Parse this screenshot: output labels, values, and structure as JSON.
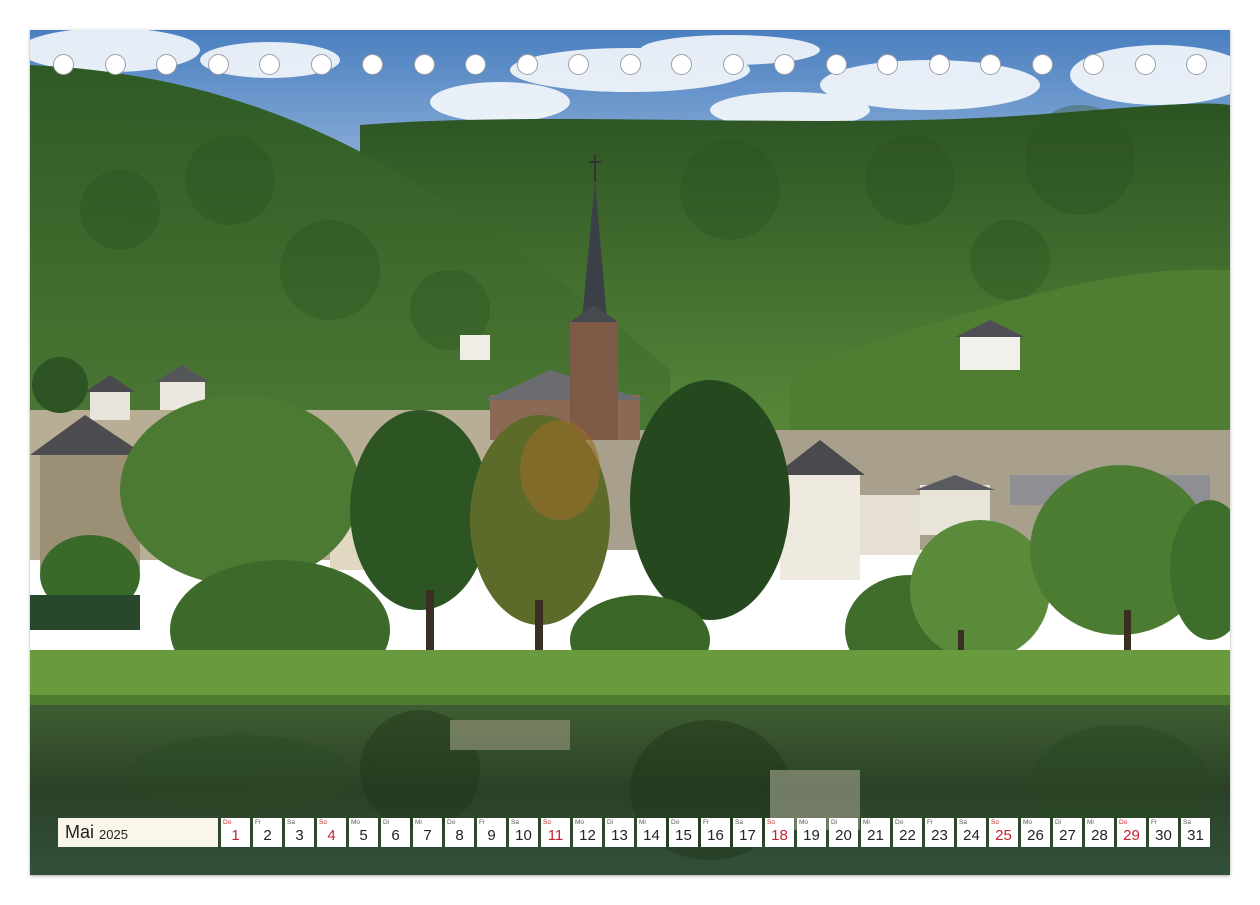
{
  "calendar": {
    "month": "Mai",
    "year": "2025",
    "days": [
      {
        "wd": "Do",
        "n": "1",
        "holiday": true
      },
      {
        "wd": "Fr",
        "n": "2",
        "holiday": false
      },
      {
        "wd": "Sa",
        "n": "3",
        "holiday": false
      },
      {
        "wd": "So",
        "n": "4",
        "holiday": true
      },
      {
        "wd": "Mo",
        "n": "5",
        "holiday": false
      },
      {
        "wd": "Di",
        "n": "6",
        "holiday": false
      },
      {
        "wd": "Mi",
        "n": "7",
        "holiday": false
      },
      {
        "wd": "Do",
        "n": "8",
        "holiday": false
      },
      {
        "wd": "Fr",
        "n": "9",
        "holiday": false
      },
      {
        "wd": "Sa",
        "n": "10",
        "holiday": false
      },
      {
        "wd": "So",
        "n": "11",
        "holiday": true
      },
      {
        "wd": "Mo",
        "n": "12",
        "holiday": false
      },
      {
        "wd": "Di",
        "n": "13",
        "holiday": false
      },
      {
        "wd": "Mi",
        "n": "14",
        "holiday": false
      },
      {
        "wd": "Do",
        "n": "15",
        "holiday": false
      },
      {
        "wd": "Fr",
        "n": "16",
        "holiday": false
      },
      {
        "wd": "Sa",
        "n": "17",
        "holiday": false
      },
      {
        "wd": "So",
        "n": "18",
        "holiday": true
      },
      {
        "wd": "Mo",
        "n": "19",
        "holiday": false
      },
      {
        "wd": "Di",
        "n": "20",
        "holiday": false
      },
      {
        "wd": "Mi",
        "n": "21",
        "holiday": false
      },
      {
        "wd": "Do",
        "n": "22",
        "holiday": false
      },
      {
        "wd": "Fr",
        "n": "23",
        "holiday": false
      },
      {
        "wd": "Sa",
        "n": "24",
        "holiday": false
      },
      {
        "wd": "So",
        "n": "25",
        "holiday": true
      },
      {
        "wd": "Mo",
        "n": "26",
        "holiday": false
      },
      {
        "wd": "Di",
        "n": "27",
        "holiday": false
      },
      {
        "wd": "Mi",
        "n": "28",
        "holiday": false
      },
      {
        "wd": "Do",
        "n": "29",
        "holiday": true
      },
      {
        "wd": "Fr",
        "n": "30",
        "holiday": false
      },
      {
        "wd": "Sa",
        "n": "31",
        "holiday": false
      }
    ]
  },
  "binding": {
    "hole_count": 23
  },
  "colors": {
    "holiday": "#c3232f",
    "sky": "#5b8fc9",
    "forest": "#3d6b2c",
    "river": "#2f4a2a"
  }
}
